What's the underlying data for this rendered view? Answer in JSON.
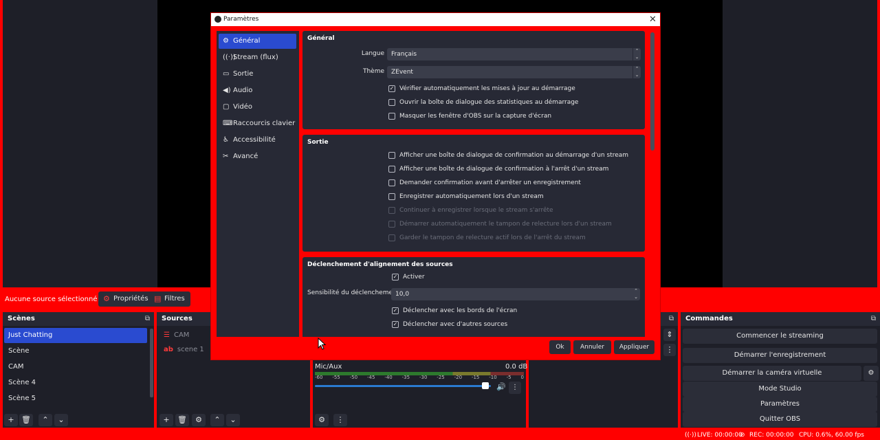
{
  "status_text": {
    "no_source": "Aucune source sélectionné",
    "live": "LIVE: 00:00:00",
    "rec": "REC: 00:00:00",
    "cpu": "CPU: 0.6%, 60.00 fps"
  },
  "source_toolbar": {
    "properties": "Propriétés",
    "filters": "Filtres"
  },
  "scenes": {
    "title": "Scènes",
    "items": [
      "Just Chatting",
      "Scène",
      "CAM",
      "Scène 4",
      "Scène 5"
    ]
  },
  "sources": {
    "title": "Sources",
    "items": [
      "CAM",
      "scene 1"
    ]
  },
  "mixer": {
    "channel": "Mic/Aux",
    "db": "0.0 dB",
    "ticks": [
      "-60",
      "-55",
      "-50",
      "-45",
      "-40",
      "-35",
      "-30",
      "-25",
      "-20",
      "-15",
      "-10",
      "-5",
      "0"
    ],
    "volume_level": 0.97
  },
  "commands": {
    "title": "Commandes",
    "start_stream": "Commencer le streaming",
    "start_rec": "Démarrer l'enregistrement",
    "start_vcam": "Démarrer la caméra virtuelle",
    "studio": "Mode Studio",
    "settings": "Paramètres",
    "quit": "Quitter OBS"
  },
  "dialog": {
    "title": "Paramètres",
    "nav": [
      "Général",
      "Stream (flux)",
      "Sortie",
      "Audio",
      "Vidéo",
      "Raccourcis clavier",
      "Accessibilité",
      "Avancé"
    ],
    "general": {
      "title": "Général",
      "language_label": "Langue",
      "language_value": "Français",
      "theme_label": "Thème",
      "theme_value": "ZEvent",
      "checks": [
        {
          "label": "Vérifier automatiquement les mises à jour au démarrage",
          "checked": true
        },
        {
          "label": "Ouvrir la boîte de dialogue des statistiques au démarrage",
          "checked": false
        },
        {
          "label": "Masquer les fenêtre d'OBS sur la capture d'écran",
          "checked": false
        }
      ]
    },
    "output": {
      "title": "Sortie",
      "checks": [
        {
          "label": "Afficher une boîte de dialogue de confirmation au démarrage d'un stream",
          "checked": false,
          "disabled": false
        },
        {
          "label": "Afficher une boîte de dialogue de confirmation à l'arrêt d'un stream",
          "checked": false,
          "disabled": false
        },
        {
          "label": "Demander confirmation avant d'arrêter un enregistrement",
          "checked": false,
          "disabled": false
        },
        {
          "label": "Enregistrer automatiquement lors d'un stream",
          "checked": false,
          "disabled": false
        },
        {
          "label": "Continuer à enregistrer lorsque le stream s'arrête",
          "checked": false,
          "disabled": true
        },
        {
          "label": "Démarrer automatiquement le tampon de relecture lors d'un stream",
          "checked": false,
          "disabled": true
        },
        {
          "label": "Garder le tampon de relecture actif lors de l'arrêt du stream",
          "checked": false,
          "disabled": true
        }
      ]
    },
    "snapping": {
      "title": "Déclenchement d'alignement des sources",
      "enable": "Activer",
      "sensitivity_label": "Sensibilité du déclenchement",
      "sensitivity_value": "10,0",
      "edges": "Déclencher avec les bords de l'écran",
      "others": "Déclencher avec d'autres sources"
    },
    "buttons": {
      "ok": "Ok",
      "cancel": "Annuler",
      "apply": "Appliquer"
    }
  }
}
